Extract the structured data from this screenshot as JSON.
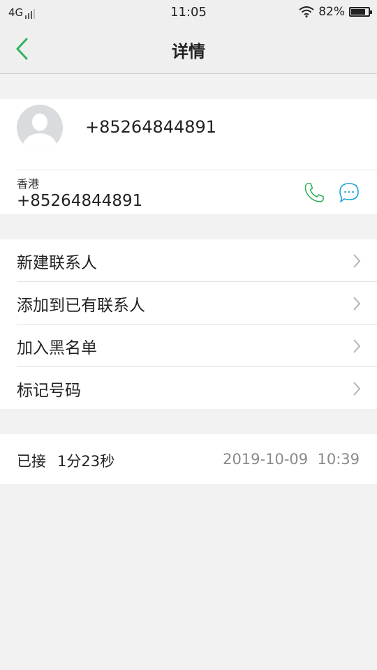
{
  "status_bar": {
    "network": "4G",
    "time": "11:05",
    "battery_text": "82%",
    "battery_level": 0.82
  },
  "header": {
    "title": "详情",
    "back_icon": "chevron-left-icon",
    "accent_color": "#2fb35a"
  },
  "contact": {
    "avatar_icon": "person-avatar-icon",
    "number": "+85264844891",
    "region": "香港",
    "number_secondary": "+85264844891",
    "call_icon": "phone-icon",
    "message_icon": "chat-bubble-icon"
  },
  "menu": {
    "items": [
      {
        "label": "新建联系人"
      },
      {
        "label": "添加到已有联系人"
      },
      {
        "label": "加入黑名单"
      },
      {
        "label": "标记号码"
      }
    ]
  },
  "call_record": {
    "status": "已接",
    "duration": "1分23秒",
    "datetime": "2019-10-09  10:39"
  }
}
